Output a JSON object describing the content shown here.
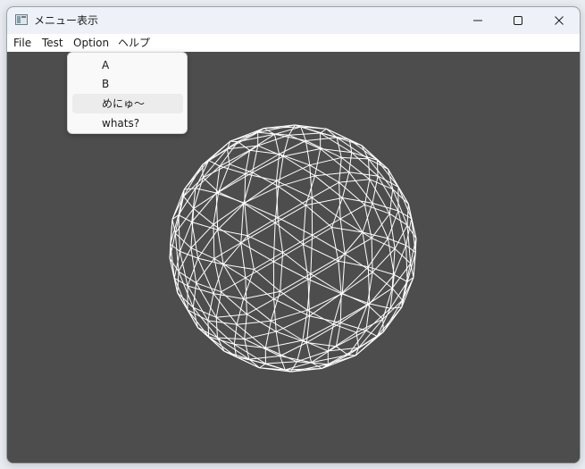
{
  "window": {
    "title": "メニュー表示"
  },
  "menubar": {
    "items": [
      "File",
      "Test",
      "Option",
      "ヘルプ"
    ]
  },
  "dropdown": {
    "parent": "Option",
    "items": [
      {
        "label": "A"
      },
      {
        "label": "B"
      },
      {
        "label": "めにゅ〜",
        "highlighted": true
      },
      {
        "label": "whats?"
      }
    ]
  },
  "viewport": {
    "background": "#4d4d4d",
    "wire_color": "#ffffff",
    "object": "wireframe-sphere"
  }
}
